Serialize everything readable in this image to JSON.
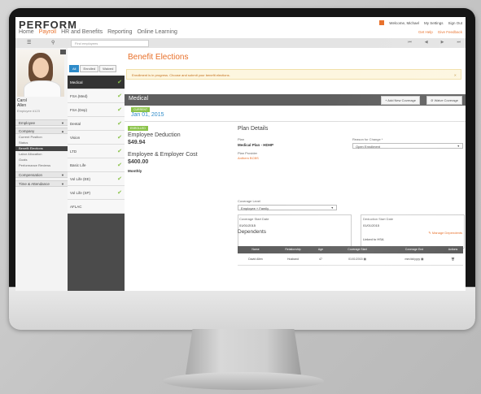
{
  "app": {
    "logo": "PERFORM",
    "nav": [
      "Home",
      "Payroll",
      "HR and Benefits",
      "Reporting",
      "Online Learning"
    ],
    "nav_active": "Payroll",
    "welcome": "Welcome, Michael",
    "my_settings": "My Settings",
    "sign_out": "Sign Out",
    "get_help": "Get Help",
    "give_feedback": "Give Feedback"
  },
  "toolbar": {
    "search_placeholder": "Find employees"
  },
  "employee": {
    "name_line1": "Carol",
    "name_line2": "Allen",
    "id": "Employee #123"
  },
  "sidebar": {
    "sections": [
      {
        "label": "Employee",
        "caret": "▼"
      },
      {
        "label": "Company",
        "caret": "▲"
      },
      {
        "label": "Compensation",
        "caret": "▼"
      },
      {
        "label": "Time & Attendance",
        "caret": "▼"
      }
    ],
    "company_items": [
      "Current Position",
      "Status",
      "Benefit Elections",
      "Labor Allocation",
      "Goals",
      "Performance Reviews"
    ],
    "active_item": "Benefit Elections"
  },
  "plan_filters": [
    "All",
    "Enrolled",
    "Waived"
  ],
  "plans": [
    {
      "label": "Medical",
      "checked": true
    },
    {
      "label": "FSA (Med)",
      "checked": true
    },
    {
      "label": "FSA (Dep)",
      "checked": true
    },
    {
      "label": "Dental",
      "checked": true
    },
    {
      "label": "Vision",
      "checked": true
    },
    {
      "label": "LTD",
      "checked": true
    },
    {
      "label": "Basic Life",
      "checked": true
    },
    {
      "label": "Vol Life (EE)",
      "checked": true
    },
    {
      "label": "Vol Life (SP)",
      "checked": true
    },
    {
      "label": "AFLAC",
      "checked": false
    }
  ],
  "main": {
    "title": "Benefit Elections",
    "alert": "Enrollment is in progress. Choose and submit your benefit elections.",
    "section": "Medical",
    "add_coverage": "+ Add New Coverage",
    "waive_coverage": "⊘ Waive Coverage",
    "current_badge": "CURRENT",
    "effective_date": "Jan 01, 2015",
    "enrolled_badge": "ENROLLED",
    "employee_deduction_label": "Employee Deduction",
    "employee_deduction": "$49.94",
    "cost_label": "Employee & Employer Cost",
    "cost": "$400.00",
    "frequency": "Monthly",
    "plan_details": "Plan Details",
    "plan_label": "Plan",
    "plan_value": "Medical Plan - HDHP",
    "reason_label": "Reason for Change *",
    "reason_value": "Open Enrollment",
    "provider_label": "Plan Provider",
    "provider_value": "Anthem BCBS",
    "coverage_level_label": "Coverage Level",
    "coverage_level_value": "Employee + Family",
    "coverage_start_label": "Coverage Start Date",
    "coverage_start_value": "01/01/2015",
    "deduction_start_label": "Deduction Start Date",
    "deduction_start_value": "01/01/2015",
    "linked_to": "Linked to HSA",
    "dependents_title": "Dependents",
    "manage_dependents": "Manage Dependents",
    "columns": [
      "Name",
      "Relationship",
      "Age",
      "Coverage Start",
      "Coverage End",
      "Actions"
    ],
    "rows": [
      {
        "name": "David Allen",
        "relationship": "Husband",
        "age": "47",
        "start": "01/01/2015",
        "end": "mm/dd/yyyy"
      }
    ]
  }
}
